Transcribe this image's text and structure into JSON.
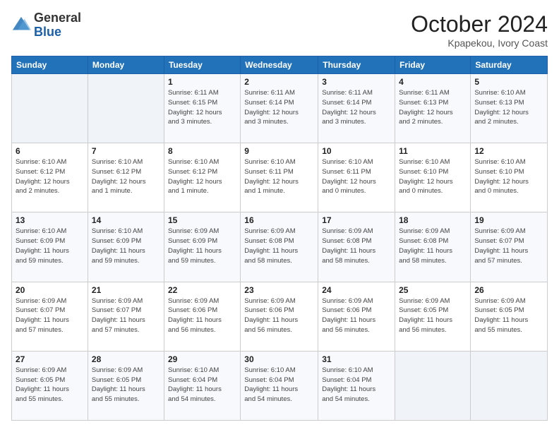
{
  "logo": {
    "text_general": "General",
    "text_blue": "Blue"
  },
  "header": {
    "month": "October 2024",
    "location": "Kpapekou, Ivory Coast"
  },
  "weekdays": [
    "Sunday",
    "Monday",
    "Tuesday",
    "Wednesday",
    "Thursday",
    "Friday",
    "Saturday"
  ],
  "weeks": [
    [
      {
        "day": "",
        "info": ""
      },
      {
        "day": "",
        "info": ""
      },
      {
        "day": "1",
        "info": "Sunrise: 6:11 AM\nSunset: 6:15 PM\nDaylight: 12 hours\nand 3 minutes."
      },
      {
        "day": "2",
        "info": "Sunrise: 6:11 AM\nSunset: 6:14 PM\nDaylight: 12 hours\nand 3 minutes."
      },
      {
        "day": "3",
        "info": "Sunrise: 6:11 AM\nSunset: 6:14 PM\nDaylight: 12 hours\nand 3 minutes."
      },
      {
        "day": "4",
        "info": "Sunrise: 6:11 AM\nSunset: 6:13 PM\nDaylight: 12 hours\nand 2 minutes."
      },
      {
        "day": "5",
        "info": "Sunrise: 6:10 AM\nSunset: 6:13 PM\nDaylight: 12 hours\nand 2 minutes."
      }
    ],
    [
      {
        "day": "6",
        "info": "Sunrise: 6:10 AM\nSunset: 6:12 PM\nDaylight: 12 hours\nand 2 minutes."
      },
      {
        "day": "7",
        "info": "Sunrise: 6:10 AM\nSunset: 6:12 PM\nDaylight: 12 hours\nand 1 minute."
      },
      {
        "day": "8",
        "info": "Sunrise: 6:10 AM\nSunset: 6:12 PM\nDaylight: 12 hours\nand 1 minute."
      },
      {
        "day": "9",
        "info": "Sunrise: 6:10 AM\nSunset: 6:11 PM\nDaylight: 12 hours\nand 1 minute."
      },
      {
        "day": "10",
        "info": "Sunrise: 6:10 AM\nSunset: 6:11 PM\nDaylight: 12 hours\nand 0 minutes."
      },
      {
        "day": "11",
        "info": "Sunrise: 6:10 AM\nSunset: 6:10 PM\nDaylight: 12 hours\nand 0 minutes."
      },
      {
        "day": "12",
        "info": "Sunrise: 6:10 AM\nSunset: 6:10 PM\nDaylight: 12 hours\nand 0 minutes."
      }
    ],
    [
      {
        "day": "13",
        "info": "Sunrise: 6:10 AM\nSunset: 6:09 PM\nDaylight: 11 hours\nand 59 minutes."
      },
      {
        "day": "14",
        "info": "Sunrise: 6:10 AM\nSunset: 6:09 PM\nDaylight: 11 hours\nand 59 minutes."
      },
      {
        "day": "15",
        "info": "Sunrise: 6:09 AM\nSunset: 6:09 PM\nDaylight: 11 hours\nand 59 minutes."
      },
      {
        "day": "16",
        "info": "Sunrise: 6:09 AM\nSunset: 6:08 PM\nDaylight: 11 hours\nand 58 minutes."
      },
      {
        "day": "17",
        "info": "Sunrise: 6:09 AM\nSunset: 6:08 PM\nDaylight: 11 hours\nand 58 minutes."
      },
      {
        "day": "18",
        "info": "Sunrise: 6:09 AM\nSunset: 6:08 PM\nDaylight: 11 hours\nand 58 minutes."
      },
      {
        "day": "19",
        "info": "Sunrise: 6:09 AM\nSunset: 6:07 PM\nDaylight: 11 hours\nand 57 minutes."
      }
    ],
    [
      {
        "day": "20",
        "info": "Sunrise: 6:09 AM\nSunset: 6:07 PM\nDaylight: 11 hours\nand 57 minutes."
      },
      {
        "day": "21",
        "info": "Sunrise: 6:09 AM\nSunset: 6:07 PM\nDaylight: 11 hours\nand 57 minutes."
      },
      {
        "day": "22",
        "info": "Sunrise: 6:09 AM\nSunset: 6:06 PM\nDaylight: 11 hours\nand 56 minutes."
      },
      {
        "day": "23",
        "info": "Sunrise: 6:09 AM\nSunset: 6:06 PM\nDaylight: 11 hours\nand 56 minutes."
      },
      {
        "day": "24",
        "info": "Sunrise: 6:09 AM\nSunset: 6:06 PM\nDaylight: 11 hours\nand 56 minutes."
      },
      {
        "day": "25",
        "info": "Sunrise: 6:09 AM\nSunset: 6:05 PM\nDaylight: 11 hours\nand 56 minutes."
      },
      {
        "day": "26",
        "info": "Sunrise: 6:09 AM\nSunset: 6:05 PM\nDaylight: 11 hours\nand 55 minutes."
      }
    ],
    [
      {
        "day": "27",
        "info": "Sunrise: 6:09 AM\nSunset: 6:05 PM\nDaylight: 11 hours\nand 55 minutes."
      },
      {
        "day": "28",
        "info": "Sunrise: 6:09 AM\nSunset: 6:05 PM\nDaylight: 11 hours\nand 55 minutes."
      },
      {
        "day": "29",
        "info": "Sunrise: 6:10 AM\nSunset: 6:04 PM\nDaylight: 11 hours\nand 54 minutes."
      },
      {
        "day": "30",
        "info": "Sunrise: 6:10 AM\nSunset: 6:04 PM\nDaylight: 11 hours\nand 54 minutes."
      },
      {
        "day": "31",
        "info": "Sunrise: 6:10 AM\nSunset: 6:04 PM\nDaylight: 11 hours\nand 54 minutes."
      },
      {
        "day": "",
        "info": ""
      },
      {
        "day": "",
        "info": ""
      }
    ]
  ]
}
